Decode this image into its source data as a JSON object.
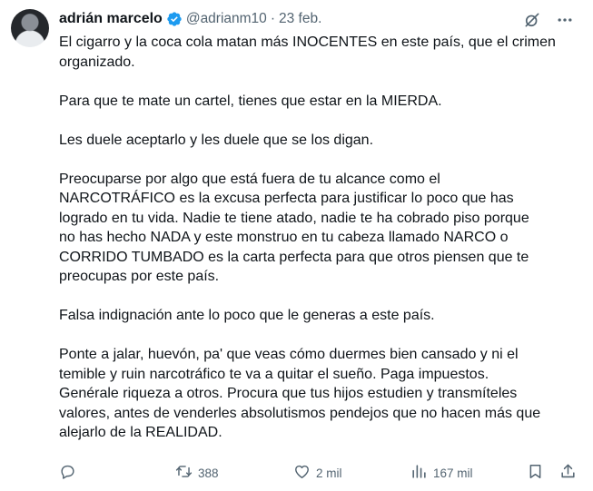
{
  "author": {
    "name": "adrián marcelo",
    "handle": "@adrianm10",
    "date": "23 feb."
  },
  "tweet": {
    "paragraphs": [
      "El cigarro y la coca cola matan más INOCENTES en este país, que el crimen\norganizado.",
      "Para que te mate un cartel, tienes que estar en la MIERDA.",
      "Les duele aceptarlo y les duele que se los digan.",
      "Preocuparse por algo que está fuera de tu alcance como el\nNARCOTRÁFICO es la excusa perfecta para justificar lo poco que has\nlogrado en tu vida. Nadie te tiene atado, nadie te ha cobrado piso porque\nno has hecho NADA y este monstruo en tu cabeza llamado NARCO o\nCORRIDO TUMBADO es la carta perfecta para que otros piensen que te\npreocupas por este país.",
      "Falsa indignación ante lo poco que le generas a este país.",
      "Ponte a jalar, huevón, pa' que veas cómo duermes bien cansado y ni el\ntemible y ruin narcotráfico te va a quitar el sueño. Paga impuestos.\nGenérale riqueza a otros. Procura que tus hijos estudien y transmíteles\nvalores, antes de venderles absolutismos pendejos que no hacen más que\nalejarlo de la REALIDAD."
    ]
  },
  "stats": {
    "retweets": "388",
    "likes": "2 mil",
    "views": "167 mil"
  },
  "colors": {
    "text": "#0f1419",
    "muted": "#536471",
    "verified": "#1d9bf0"
  },
  "icons": [
    "verified-badge-icon",
    "grok-icon",
    "more-icon",
    "reply-icon",
    "retweet-icon",
    "like-icon",
    "views-icon",
    "bookmark-icon",
    "share-icon"
  ]
}
